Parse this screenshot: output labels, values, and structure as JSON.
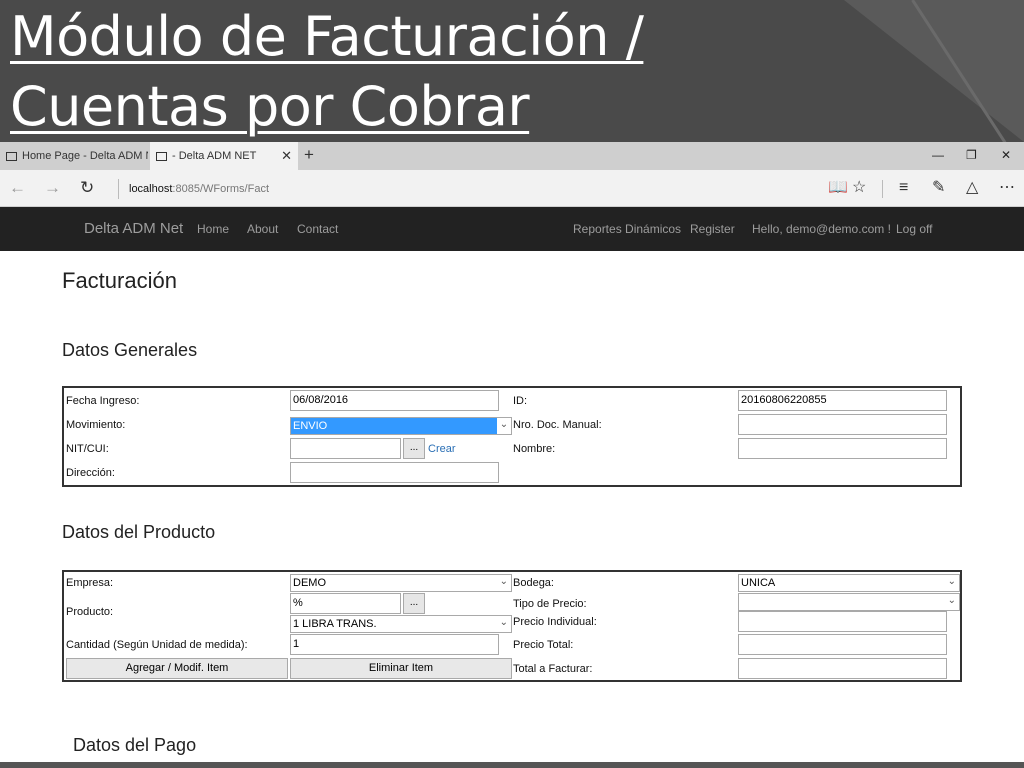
{
  "slide": {
    "title": "Módulo de Facturación / Cuentas por Cobrar"
  },
  "browser": {
    "tabs": [
      {
        "label": "Home Page - Delta ADM NE"
      },
      {
        "label": "- Delta ADM NET",
        "close": "✕"
      }
    ],
    "new_tab": "+",
    "window_controls": {
      "minimize": "—",
      "restore": "❐",
      "close": "✕"
    },
    "nav": {
      "back": "←",
      "forward": "→",
      "refresh": "↻"
    },
    "url": {
      "host": "localhost",
      "path": ":8085/WForms/Fact"
    },
    "toolbar_icons": [
      "reading-view-icon",
      "favorite-star-icon",
      "hub-icon",
      "web-note-icon",
      "share-icon",
      "more-icon"
    ]
  },
  "navbar": {
    "brand": "Delta ADM Net",
    "left_links": [
      "Home",
      "About",
      "Contact"
    ],
    "right_links": [
      "Reportes Dinámicos",
      "Register",
      "Hello, demo@demo.com !",
      "Log off"
    ]
  },
  "page": {
    "title": "Facturación",
    "general": {
      "heading": "Datos Generales",
      "fecha_label": "Fecha Ingreso:",
      "fecha_value": "06/08/2016",
      "id_label": "ID:",
      "id_value": "20160806220855",
      "movimiento_label": "Movimiento:",
      "movimiento_value": "ENVIO",
      "nro_doc_label": "Nro. Doc. Manual:",
      "nro_doc_value": "",
      "nit_label": "NIT/CUI:",
      "nit_value": "",
      "nit_button": "...",
      "crear_link": "Crear",
      "nombre_label": "Nombre:",
      "nombre_value": "",
      "direccion_label": "Dirección:",
      "direccion_value": ""
    },
    "product": {
      "heading": "Datos del Producto",
      "empresa_label": "Empresa:",
      "empresa_value": "DEMO",
      "bodega_label": "Bodega:",
      "bodega_value": "UNICA",
      "producto_label": "Producto:",
      "producto_search_value": "%",
      "producto_button": "...",
      "producto_select_value": "1 LIBRA TRANS.",
      "tipo_precio_label": "Tipo de Precio:",
      "tipo_precio_value": "",
      "precio_individual_label": "Precio Individual:",
      "precio_individual_value": "",
      "cantidad_label": "Cantidad (Según Unidad de medida):",
      "cantidad_value": "1",
      "precio_total_label": "Precio Total:",
      "precio_total_value": "",
      "agregar_button": "Agregar / Modif. Item",
      "eliminar_button": "Eliminar Item",
      "total_facturar_label": "Total a Facturar:",
      "total_facturar_value": ""
    },
    "payment": {
      "heading": "Datos del Pago"
    }
  }
}
